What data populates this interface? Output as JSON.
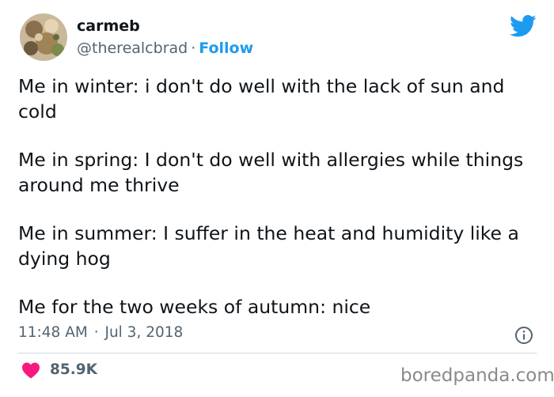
{
  "author": {
    "display_name": "carmeb",
    "handle": "@therealcbrad",
    "separator": "·",
    "follow_label": "Follow"
  },
  "tweet": {
    "paragraphs": [
      "Me in winter: i don't do well with the lack of sun and cold",
      "Me in spring: I don't do well with allergies while things around me thrive",
      "Me in summer: I suffer in the heat and humidity like a dying hog",
      "Me for the two weeks of autumn: nice"
    ],
    "time": "11:48 AM",
    "date_separator": "·",
    "date": "Jul 3, 2018"
  },
  "engagement": {
    "likes": "85.9K"
  },
  "watermark": "boredpanda.com",
  "icons": {
    "brand": "twitter-bird-icon",
    "info": "info-icon",
    "like": "heart-icon"
  },
  "colors": {
    "twitter_blue": "#1d9bf0",
    "like_pink": "#f91880",
    "text_primary": "#0f1419",
    "text_secondary": "#536471",
    "divider": "#cfd9de"
  }
}
